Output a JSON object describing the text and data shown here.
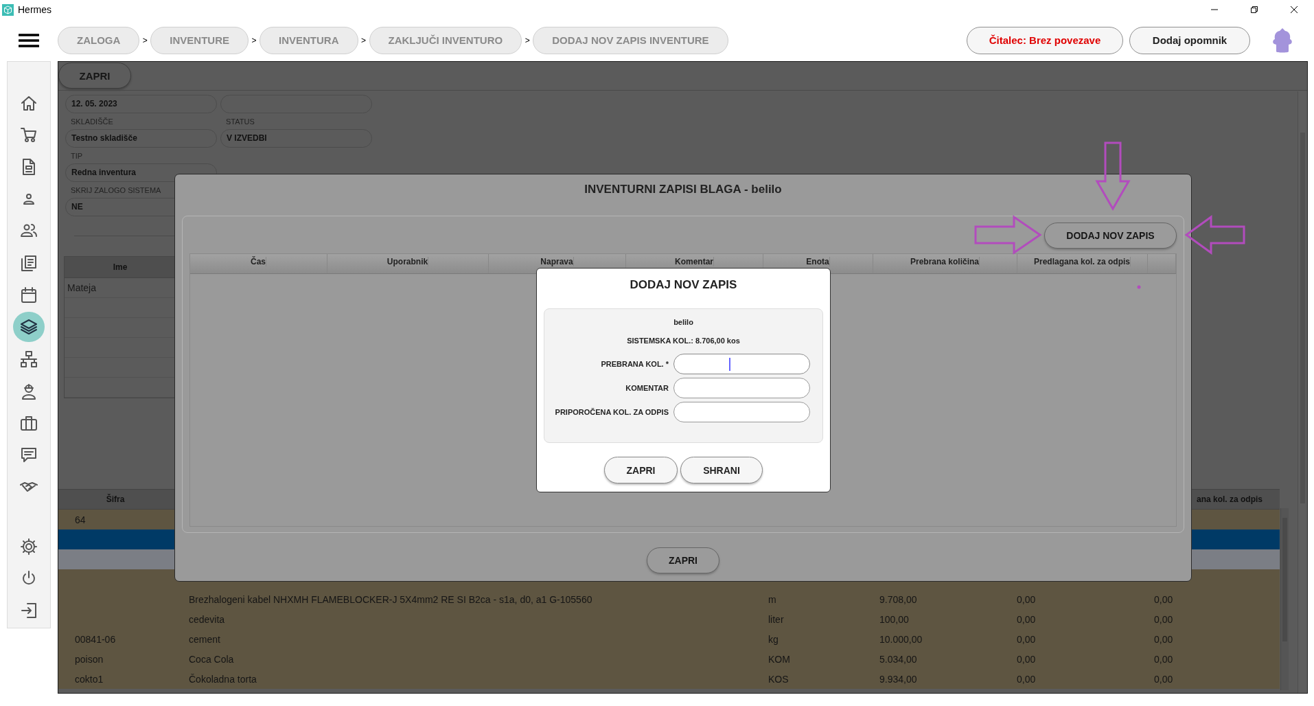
{
  "window": {
    "title": "Hermes"
  },
  "breadcrumbs": [
    {
      "label": "ZALOGA"
    },
    {
      "label": "INVENTURE"
    },
    {
      "label": "INVENTURA"
    },
    {
      "label": "ZAKLJUČI INVENTURO"
    },
    {
      "label": "DODAJ NOV ZAPIS INVENTURE"
    }
  ],
  "breadcrumb_separators": [
    ">",
    ">",
    ">",
    ">"
  ],
  "header_buttons": [
    {
      "label": "Čitalec: Brez povezave",
      "kind": "alert"
    },
    {
      "label": "Dodaj opomnik",
      "kind": "normal"
    }
  ],
  "sidebar": {
    "items": [
      {
        "selected": false
      },
      {
        "selected": false
      },
      {
        "selected": false
      },
      {
        "selected": false
      },
      {
        "selected": false
      },
      {
        "selected": false
      },
      {
        "selected": false
      },
      {
        "selected": true
      },
      {
        "selected": false
      },
      {
        "selected": false
      },
      {
        "selected": false
      },
      {
        "selected": false
      },
      {
        "selected": false
      }
    ],
    "bottom_items": [
      {
        "selected": false
      },
      {
        "selected": false
      },
      {
        "selected": false
      }
    ]
  },
  "background": {
    "close_button": "ZAPRI",
    "form_rows": [
      [
        {
          "value": "12. 05. 2023"
        },
        {}
      ],
      [
        {
          "label": "SKLADIŠČE",
          "value": "Testno skladišče"
        },
        {
          "label": "STATUS",
          "value": "V IZVEDBI"
        }
      ],
      [
        {
          "label": "TIP",
          "value": "Redna inventura"
        }
      ],
      [
        {
          "label": "SKRIJ ZALOGO SISTEMA",
          "value": "NE"
        }
      ]
    ],
    "names_table": {
      "columns": [
        "Ime"
      ],
      "rows": [
        [
          "Mateja"
        ]
      ]
    },
    "items_table": {
      "columns": [
        {
          "label": "Šifra"
        },
        {
          "label": "ana kol. za odpis"
        }
      ],
      "rows": [
        {
          "kind": "item",
          "selected": false,
          "cells": {
            "column_1": "64"
          }
        },
        {
          "kind": "item",
          "selected": true
        },
        {
          "kind": "blank",
          "selected": false
        },
        {
          "kind": "item",
          "selected": false
        },
        {
          "kind": "item",
          "selected": false,
          "cells": {
            "column_2": "Brezhalogeni kabel NHXMH FLAMEBLOCKER-J 5X4mm2 RE SI B2ca - s1a, d0, a1 G-105560",
            "column_3": "m",
            "column_4": "9.708,00",
            "column_5": "0,00",
            "column_6": "0,00"
          }
        },
        {
          "kind": "item",
          "selected": false,
          "cells": {
            "column_2": "cedevita",
            "column_3": "liter",
            "column_4": "100,00",
            "column_5": "0,00",
            "column_6": "0,00"
          }
        },
        {
          "kind": "item",
          "selected": false,
          "cells": {
            "column_1": "00841-06",
            "column_2": "cement",
            "column_3": "kg",
            "column_4": "10.000,00",
            "column_5": "0,00",
            "column_6": "0,00"
          }
        },
        {
          "kind": "item",
          "selected": false,
          "cells": {
            "column_1": "poison",
            "column_2": "Coca Cola",
            "column_3": "KOM",
            "column_4": "5.034,00",
            "column_5": "0,00",
            "column_6": "0,00"
          }
        },
        {
          "kind": "item",
          "selected": false,
          "cells": {
            "column_1": "cokto1",
            "column_2": "Čokoladna torta",
            "column_3": "KOS",
            "column_4": "9.934,00",
            "column_5": "0,00",
            "column_6": "0,00"
          }
        }
      ]
    }
  },
  "records_dialog": {
    "title": "INVENTURNI ZAPISI BLAGA - belilo",
    "add_button": "DODAJ NOV ZAPIS",
    "columns": [
      "Čas",
      "Uporabnik",
      "Naprava",
      "Komentar",
      "Enota",
      "Prebrana količina",
      "Predlagana kol. za odpis"
    ],
    "close_button": "ZAPRI"
  },
  "add_dialog": {
    "title": "DODAJ NOV ZAPIS",
    "item": "belilo",
    "system_quantity": "SISTEMSKA KOL.: 8.706,00 kos",
    "fields": [
      {
        "label": "PREBRANA KOL. *",
        "focused": true
      },
      {
        "label": "KOMENTAR",
        "focused": false
      },
      {
        "label": "PRIPOROČENA KOL. ZA ODPIS",
        "focused": false
      }
    ],
    "buttons": [
      "ZAPRI",
      "SHRANI"
    ]
  },
  "annotations": [
    {
      "kind": "arrow-down"
    },
    {
      "kind": "arrow-right"
    },
    {
      "kind": "arrow-left"
    },
    {
      "kind": "dot"
    }
  ]
}
